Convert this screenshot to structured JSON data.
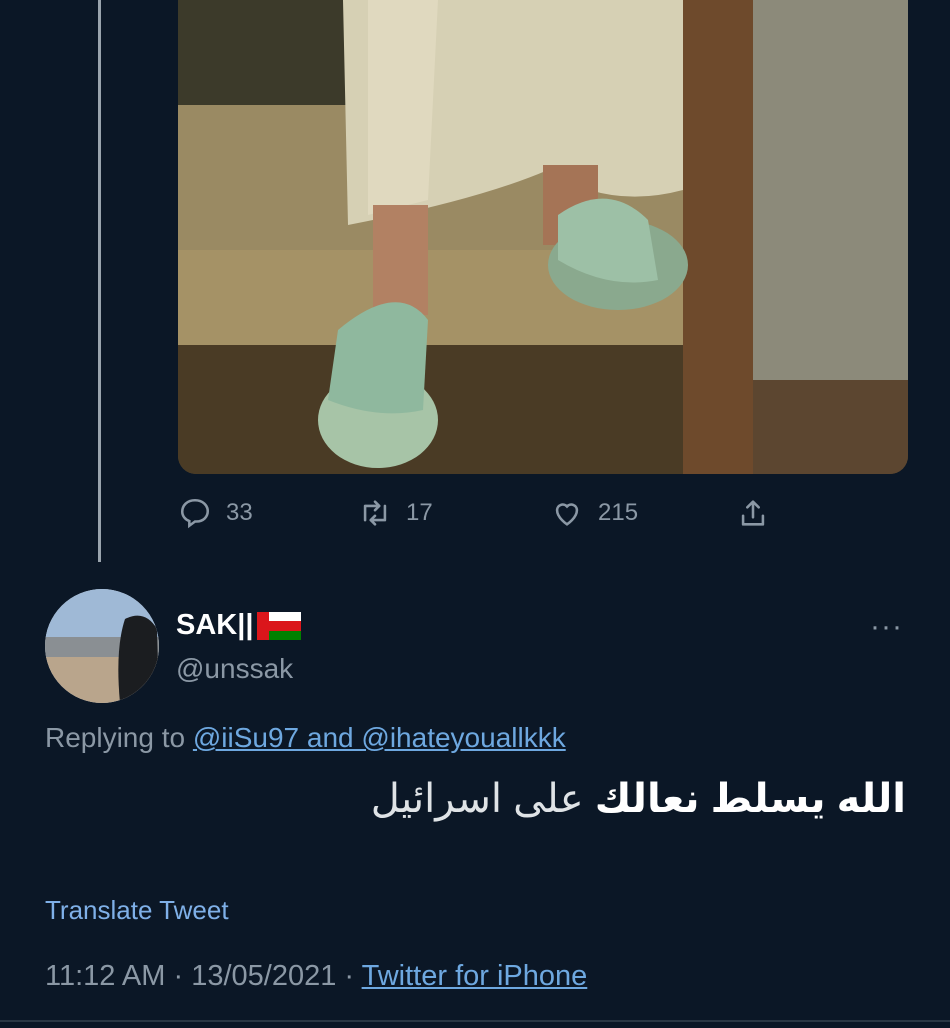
{
  "parent_tweet": {
    "stats": {
      "replies": "33",
      "retweets": "17",
      "likes": "215"
    },
    "icons": [
      "reply-icon",
      "retweet-icon",
      "like-icon",
      "share-icon"
    ]
  },
  "reply_tweet": {
    "display_name": "SAK||",
    "flag": "oman-flag",
    "handle": "@unssak",
    "replying_prefix": "Replying to",
    "replying_targets": "@iiSu97 and @ihateyouallkkk",
    "text_bold": "الله يسلط نعالك",
    "text_regular": "على اسرائيل",
    "translate_label": "Translate Tweet",
    "time": "11:12 AM",
    "date": "13/05/2021",
    "separator": "·",
    "source": "Twitter for iPhone",
    "more_label": "···"
  },
  "colors": {
    "background": "#0b1726",
    "secondary_text": "#8b98a5",
    "link": "#6ea8e0"
  }
}
